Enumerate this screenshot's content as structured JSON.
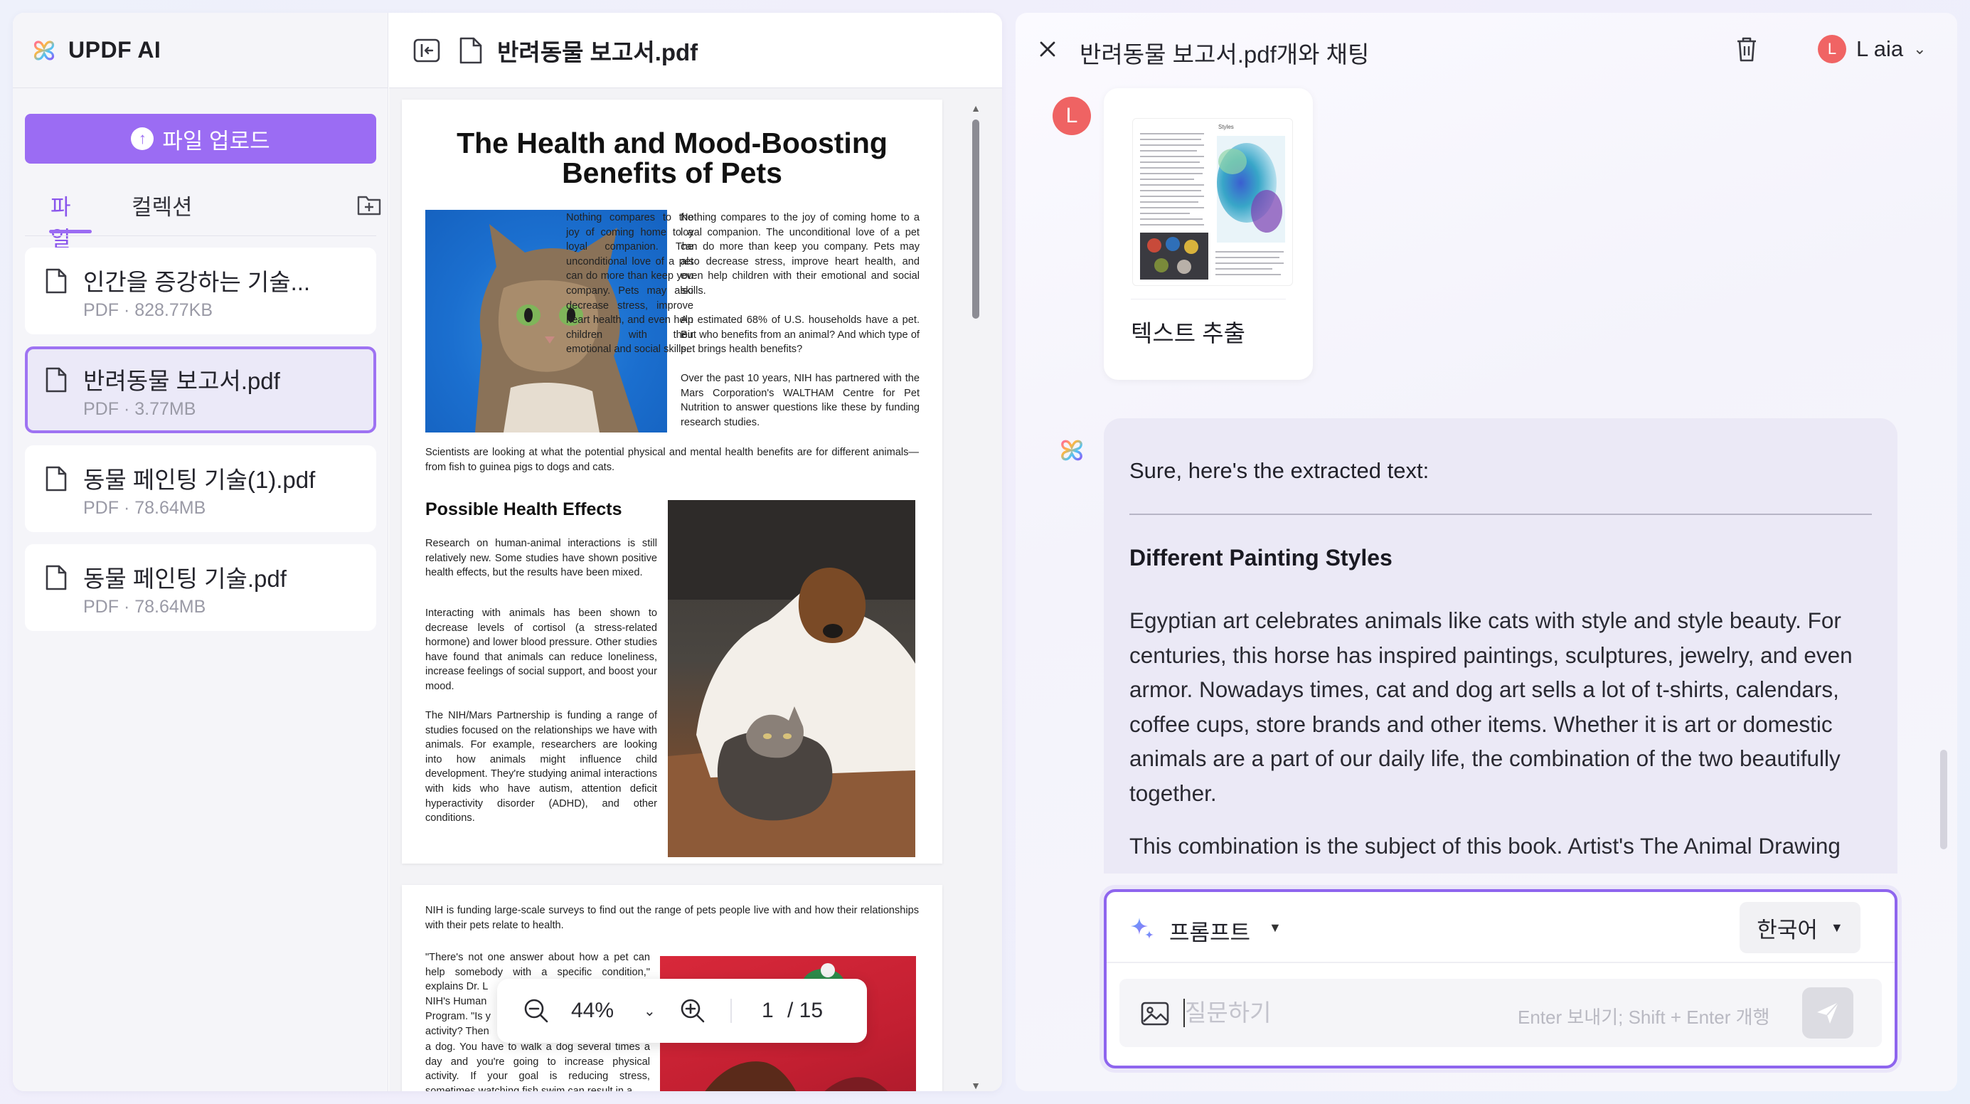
{
  "sidebar": {
    "brand": "UPDF AI",
    "upload_label": "파일 업로드",
    "tabs": [
      {
        "label": "파일",
        "active": true
      },
      {
        "label": "컬렉션",
        "active": false
      }
    ],
    "files": [
      {
        "name": "인간을 증강하는 기술...",
        "meta": "PDF · 828.77KB",
        "selected": false
      },
      {
        "name": "반려동물 보고서.pdf",
        "meta": "PDF · 3.77MB",
        "selected": true
      },
      {
        "name": "동물 페인팅 기술(1).pdf",
        "meta": "PDF · 78.64MB",
        "selected": false
      },
      {
        "name": "동물 페인팅 기술.pdf",
        "meta": "PDF · 78.64MB",
        "selected": false
      }
    ]
  },
  "viewer": {
    "doc_title": "반려동물 보고서.pdf",
    "page1": {
      "title_line1": "The Health and Mood-Boosting",
      "title_line2": "Benefits of Pets",
      "para1": "Nothing compares to the joy of coming home to a loyal companion. The unconditional love of a pet can do more than keep you company. Pets may also decrease stress, improve heart health, and even help children with their emotional and social skills.",
      "para2": "An estimated 68% of U.S. households have a pet. But who benefits from an animal? And which type of pet brings health benefits?",
      "para3": "Over the past 10 years, NIH has partnered with the Mars Corporation's WALTHAM Centre for Pet Nutrition to answer questions like these by funding research studies.",
      "para4": "Scientists are looking at what the potential physical and mental health benefits are for different animals—from fish to guinea pigs to dogs and cats.",
      "heading": "Possible Health Effects",
      "para5": "Research on human-animal interactions is still relatively new. Some studies have shown positive health effects, but the results have been mixed.",
      "para6": "Interacting with animals has been shown to decrease levels of cortisol (a stress-related hormone) and lower blood pressure. Other studies have found that animals can reduce loneliness, increase feelings of social support, and boost your mood.",
      "para7": "The NIH/Mars Partnership is funding a range of studies focused on the relationships we have with animals. For example, researchers are looking into how animals might influence child development. They're studying animal interactions with kids who have autism, attention deficit hyperactivity disorder (ADHD), and other conditions."
    },
    "page2": {
      "para1": "NIH is funding large-scale surveys to find out the range of pets people live with and how their relationships with their pets relate to health.",
      "para2": "\"There's not one answer about how a pet can help somebody with a specific condition,\" explains Dr. L",
      "para3": "NIH's Human",
      "para4": "Program. \"Is y",
      "para5": "activity? Then",
      "para6": "a dog. You have to walk a dog several times a day and you're going to increase physical activity. If your goal is reducing stress, sometimes watching fish swim can result in a"
    },
    "zoom": {
      "value": "44%",
      "page_current": "1",
      "page_total": "/ 15"
    }
  },
  "chat": {
    "title": "반려동물 보고서.pdf개와 채팅",
    "user_initial": "L",
    "user_name": "L aia",
    "user_card_label": "텍스트 추출",
    "thumb_heading": "Styles",
    "ai_intro": "Sure, here's the extracted text:",
    "ai_heading": "Different Painting Styles",
    "ai_para1": "Egyptian art celebrates animals like cats with style and style beauty. For centuries, this horse has inspired paintings, sculptures, jewelry, and even armor. Nowadays times, cat and dog art sells a lot of t-shirts, calendars, coffee cups, store brands and other items. Whether it is art or domestic animals are a part of our daily life, the combination of the two beautifully together.",
    "ai_para2": "This combination is the subject of this book. Artist's The Animal Drawing",
    "prompt_label": "프롬프트",
    "language": "한국어",
    "input_placeholder": "질문하기",
    "input_hint": "Enter 보내기; Shift + Enter 개행"
  },
  "colors": {
    "accent": "#9b6cf3",
    "accent_border": "#8e65ee",
    "avatar": "#ef6363",
    "selected_card_bg": "#ebe9f8",
    "ai_bubble_bg": "#ebe9f6"
  }
}
